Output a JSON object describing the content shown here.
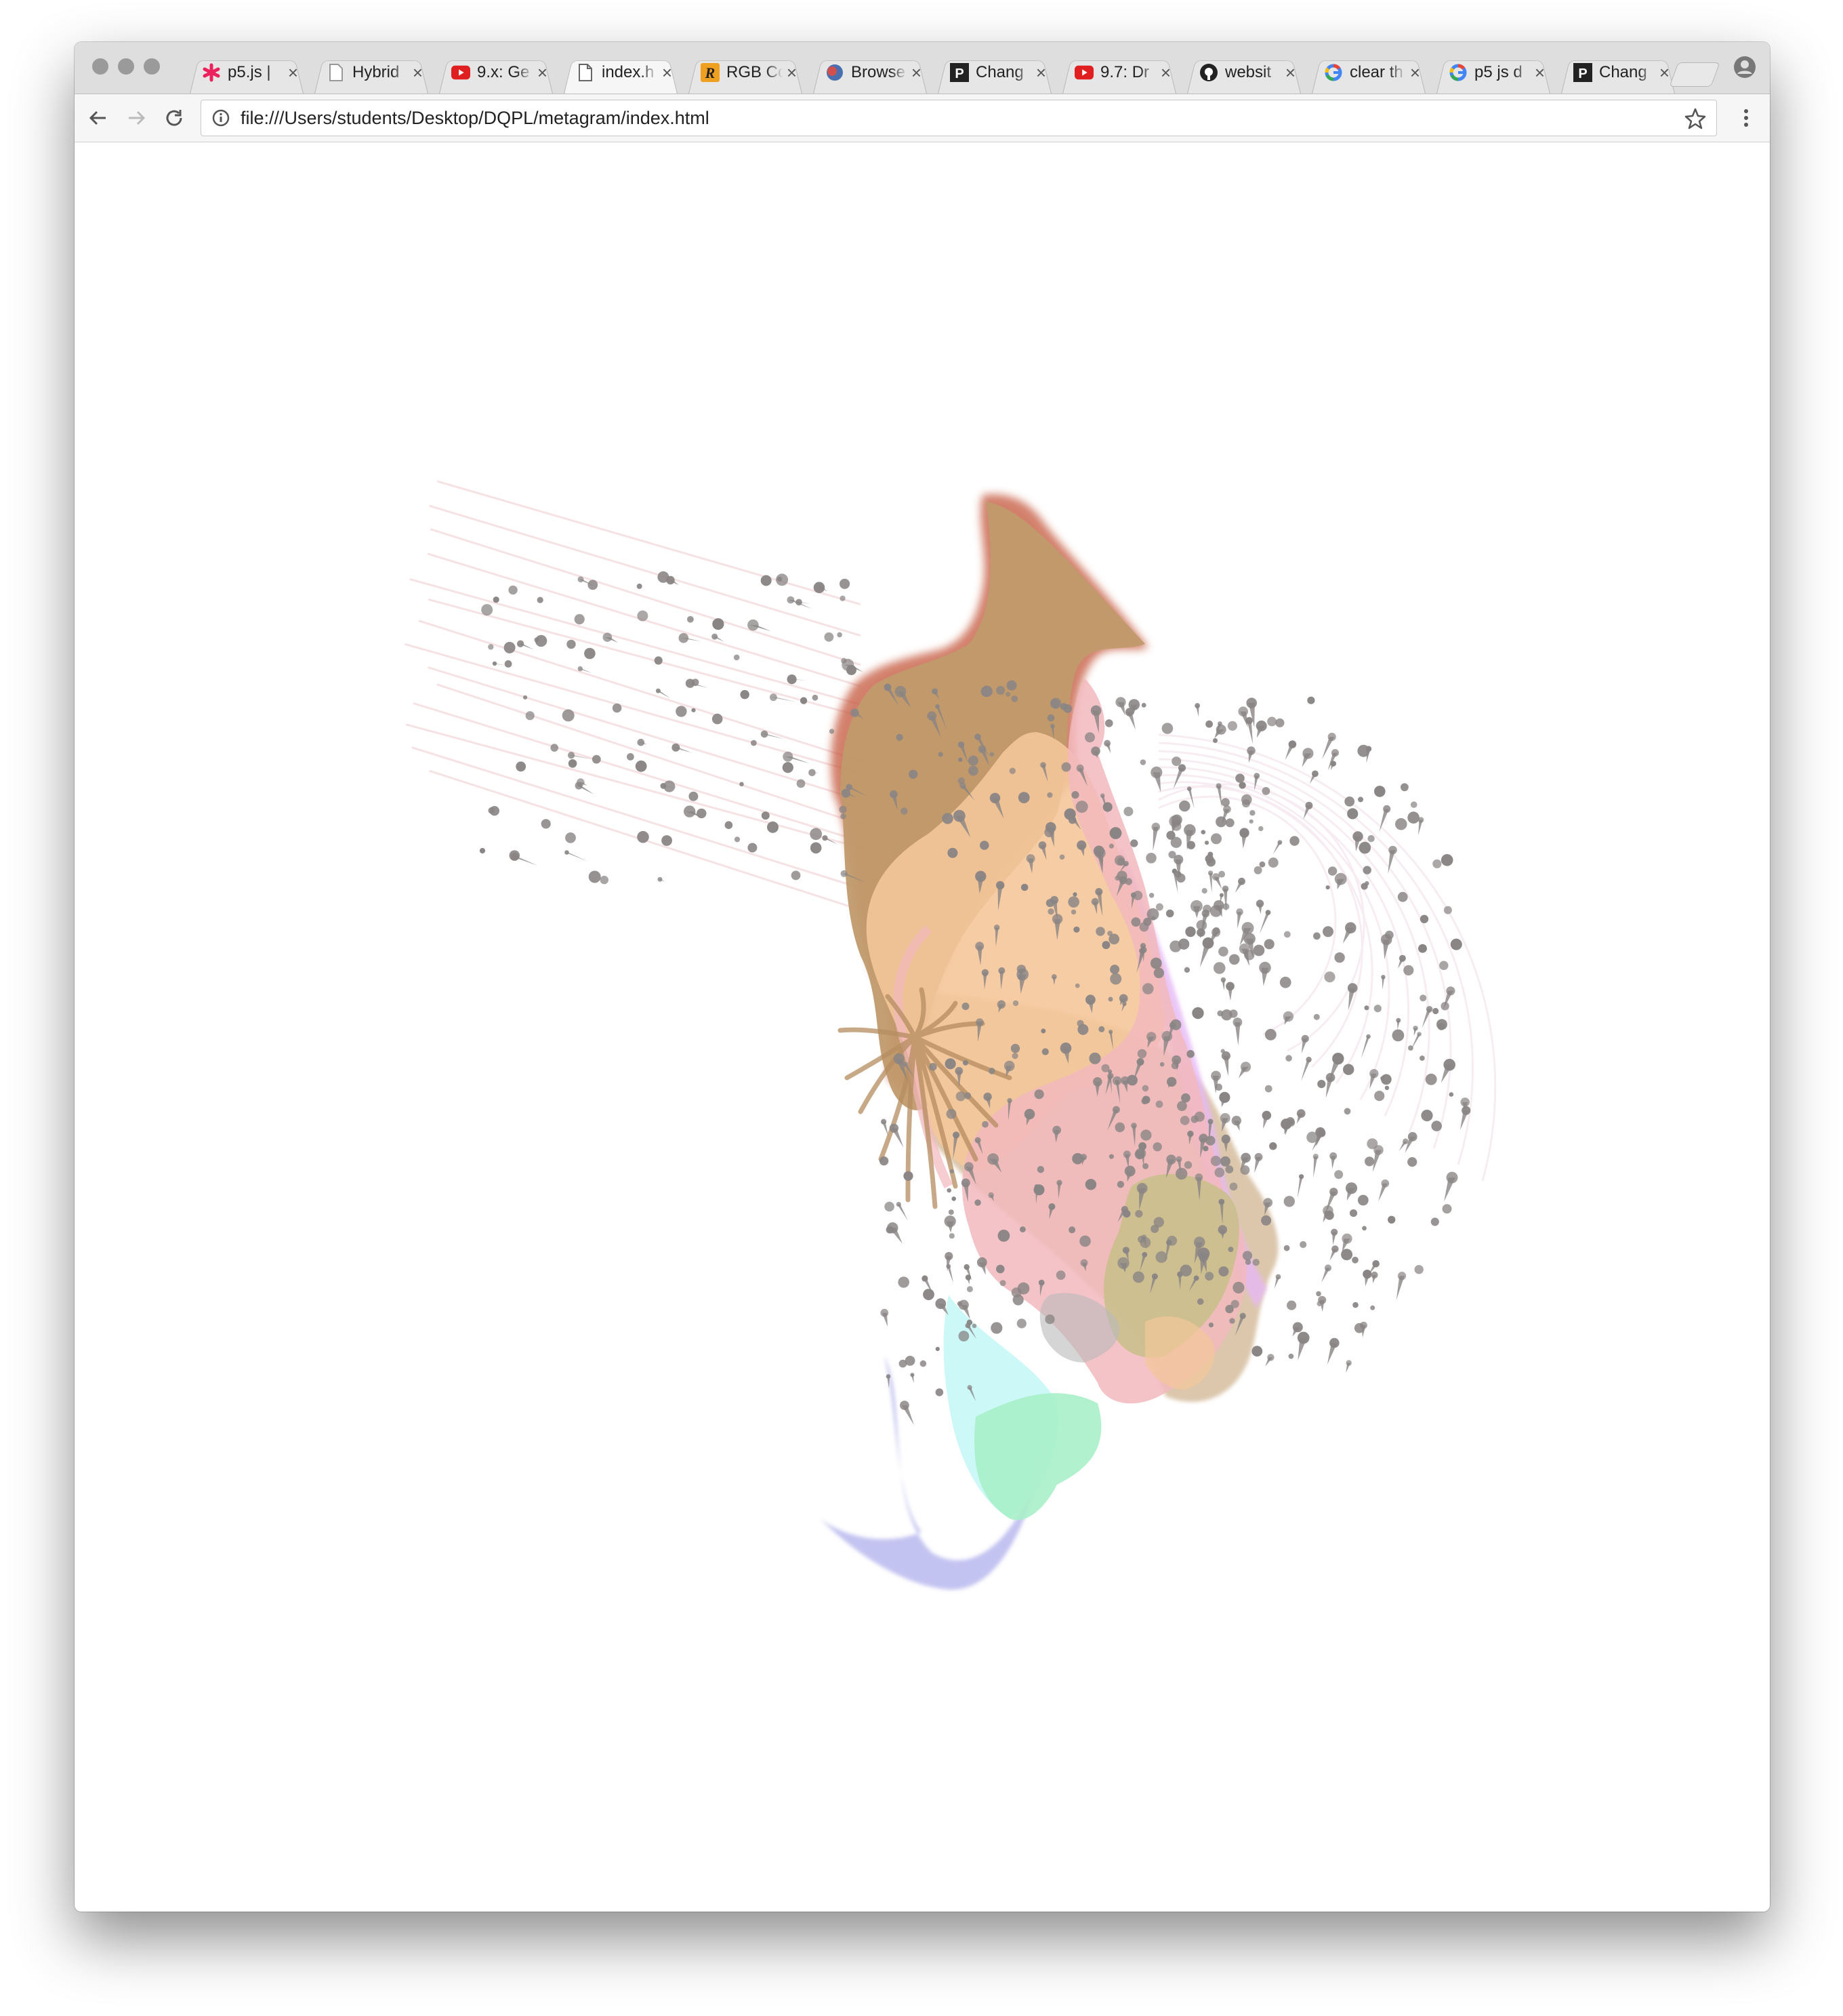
{
  "browser": {
    "tabs": [
      {
        "title": "p5.js |",
        "icon": "p5-asterisk-icon"
      },
      {
        "title": "Hybrid",
        "icon": "page-icon"
      },
      {
        "title": "9.x: Ge",
        "icon": "youtube-icon"
      },
      {
        "title": "index.h",
        "icon": "document-icon",
        "active": true
      },
      {
        "title": "RGB Co",
        "icon": "r-logo-icon"
      },
      {
        "title": "Browse",
        "icon": "globe-icon"
      },
      {
        "title": "Chang",
        "icon": "p-logo-icon"
      },
      {
        "title": "9.7: Dr",
        "icon": "youtube-icon"
      },
      {
        "title": "websit",
        "icon": "github-icon"
      },
      {
        "title": "clear th",
        "icon": "google-icon"
      },
      {
        "title": "p5 js d",
        "icon": "google-icon"
      },
      {
        "title": "Chang",
        "icon": "p-logo-icon"
      }
    ],
    "close_glyph": "×",
    "address": {
      "url": "file:///Users/students/Desktop/DQPL/metagram/index.html"
    }
  },
  "colors": {
    "tab_bar": "#dedede",
    "toolbar": "#f6f6f6",
    "brown": "#c09a6b",
    "rust": "#c4563a",
    "peach": "#f4c79a",
    "pink": "#f2b8bd",
    "olive": "#c8c08a",
    "mint": "#a8f0c8",
    "cyan": "#c6f7f7",
    "lavender": "#b9b9ef",
    "dots": "#8a8585"
  }
}
